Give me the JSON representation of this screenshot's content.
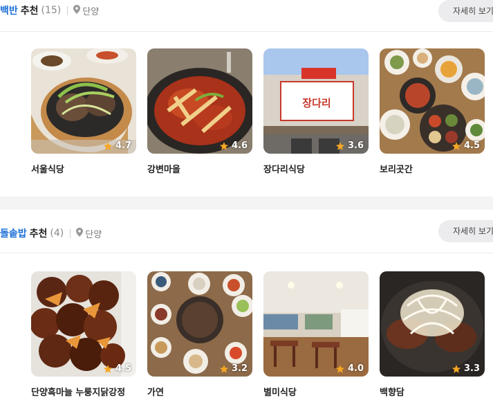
{
  "sections": [
    {
      "keyword": "백반",
      "title_rest": "추천",
      "count": "(15)",
      "location": "단양",
      "more_label": "자세히 보기",
      "restaurants": [
        {
          "name": "서울식당",
          "rating": "4.7"
        },
        {
          "name": "강변마을",
          "rating": "4.6"
        },
        {
          "name": "장다리식당",
          "rating": "3.6"
        },
        {
          "name": "보리곳간",
          "rating": "4.5"
        }
      ]
    },
    {
      "keyword": "돌솥밥",
      "title_rest": "추천",
      "count": "(4)",
      "location": "단양",
      "more_label": "자세히 보기",
      "restaurants": [
        {
          "name": "단양흑마늘 누룽지닭강정",
          "rating": "4.5"
        },
        {
          "name": "가연",
          "rating": "3.2"
        },
        {
          "name": "별미식당",
          "rating": "4.0"
        },
        {
          "name": "백향담",
          "rating": "3.3"
        }
      ]
    }
  ],
  "sign_text": "장다리",
  "icons": {
    "location": "map-pin-icon",
    "rating": "star-icon"
  },
  "colors": {
    "keyword": "#1d6fd8",
    "star": "#f5a623"
  }
}
